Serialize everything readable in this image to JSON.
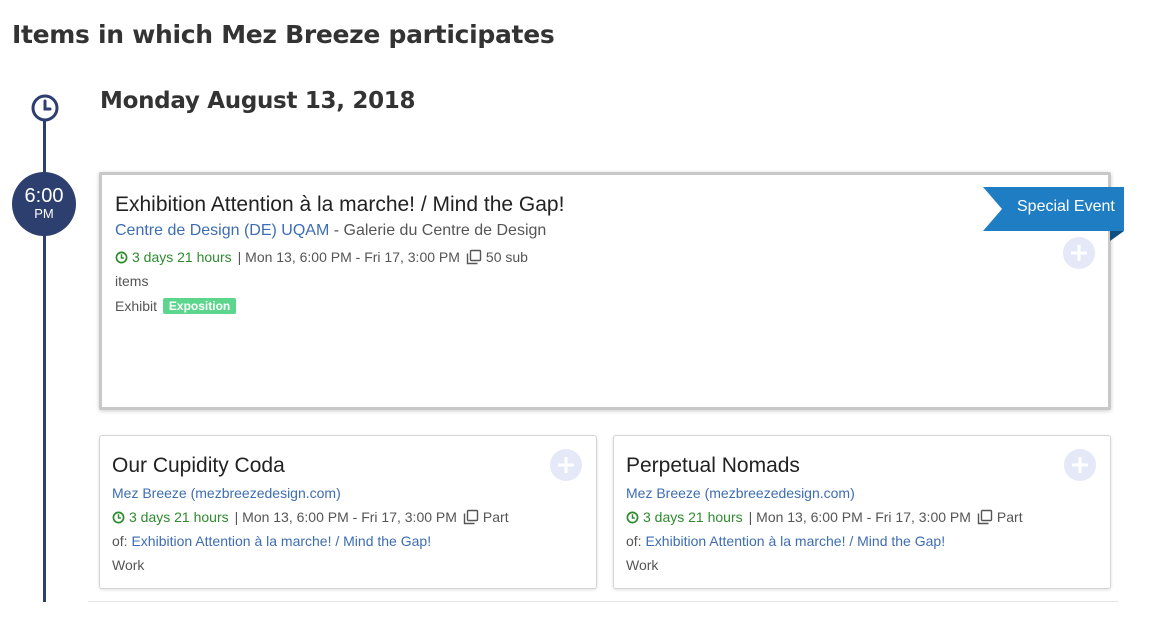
{
  "page": {
    "heading": "Items in which Mez Breeze participates"
  },
  "timeline": {
    "date": "Monday August 13, 2018",
    "time": "6:00",
    "ampm": "PM"
  },
  "colors": {
    "timeline": "#2d3f6e",
    "link": "#3d6db3",
    "duration": "#2e8b2e",
    "ribbon": "#1f7dc4",
    "tag": "#5cd68d",
    "add_button": "#e4e8f7"
  },
  "featured": {
    "title": "Exhibition Attention à la marche! / Mind the Gap!",
    "org": "Centre de Design (DE) UQAM",
    "separator": " - ",
    "venue": "Galerie du Centre de Design",
    "duration": "3 days 21 hours",
    "dates": "| Mon 13, 6:00 PM - Fri 17, 3:00 PM",
    "sub_items": "50 sub",
    "sub_items_cont": "items",
    "type": "Exhibit",
    "tag": "Exposition",
    "ribbon": "Special Event",
    "icons": {
      "duration": "clock-icon",
      "sub_items": "copy-icon",
      "add": "plus-icon"
    }
  },
  "items": [
    {
      "title": "Our Cupidity Coda",
      "org": "Mez Breeze (mezbreezedesign.com)",
      "duration": "3 days 21 hours",
      "dates": "| Mon 13, 6:00 PM - Fri 17, 3:00 PM",
      "part_label": "Part",
      "part_of_label": "of:",
      "part_of_link": "Exhibition Attention à la marche! / Mind the Gap!",
      "type": "Work"
    },
    {
      "title": "Perpetual Nomads",
      "org": "Mez Breeze (mezbreezedesign.com)",
      "duration": "3 days 21 hours",
      "dates": "| Mon 13, 6:00 PM - Fri 17, 3:00 PM",
      "part_label": "Part",
      "part_of_label": "of:",
      "part_of_link": "Exhibition Attention à la marche! / Mind the Gap!",
      "type": "Work"
    }
  ]
}
